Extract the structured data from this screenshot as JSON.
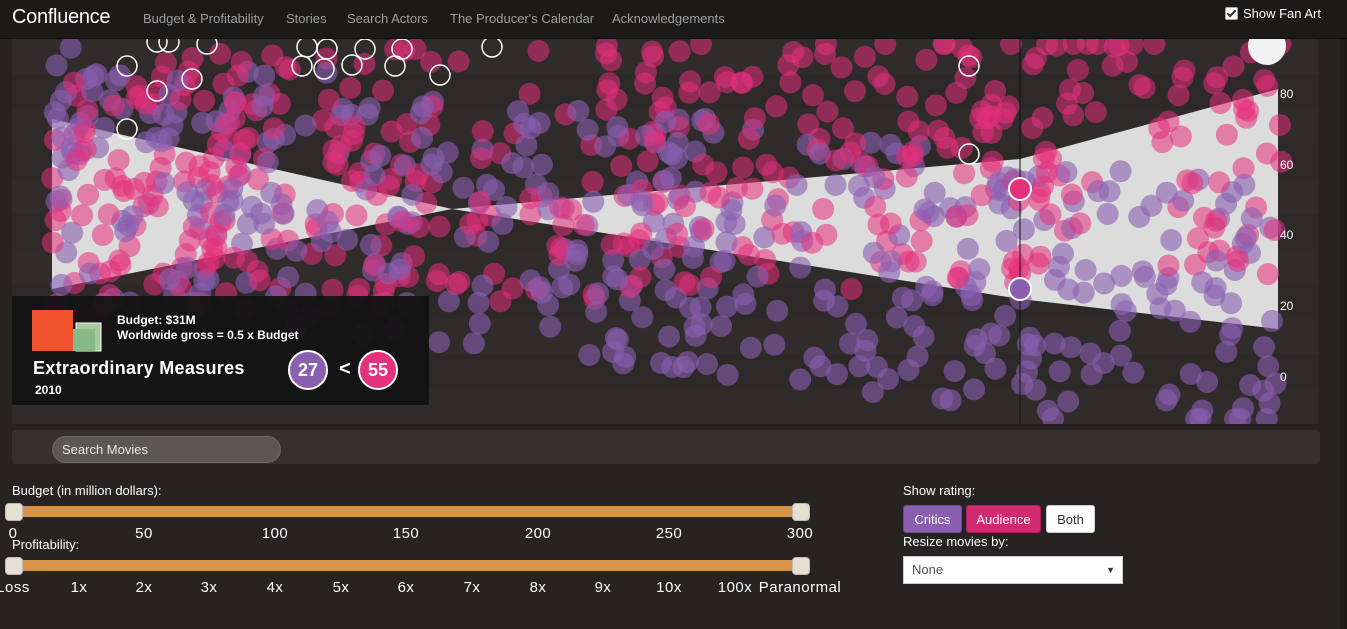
{
  "nav": {
    "brand": "Confluence",
    "items": [
      "Budget & Profitability",
      "Stories",
      "Search Actors",
      "The Producer's Calendar",
      "Acknowledgements"
    ],
    "fan_art_label": "Show Fan Art",
    "fan_art_checked": true
  },
  "plot": {
    "y_ticks": [
      "80",
      "60",
      "40",
      "20",
      "0"
    ],
    "colors": {
      "critics": "#8b5fb0",
      "audience": "#e5307c",
      "band": "#dcdcdc"
    }
  },
  "movie": {
    "budget": "Budget: $31M",
    "gross": "Worldwide gross = 0.5 x Budget",
    "title": "Extraordinary Measures",
    "year": "2010",
    "critics_score": "27",
    "comparator": "<",
    "audience_score": "55"
  },
  "search": {
    "placeholder": "Search Movies"
  },
  "budget_slider": {
    "label": "Budget (in million dollars):",
    "ticks": [
      "0",
      "50",
      "100",
      "150",
      "200",
      "250",
      "300"
    ]
  },
  "profit_slider": {
    "label": "Profitability:",
    "ticks": [
      "Loss",
      "1x",
      "2x",
      "3x",
      "4x",
      "5x",
      "6x",
      "7x",
      "8x",
      "9x",
      "10x",
      "100x",
      "Paranormal"
    ]
  },
  "rating": {
    "label": "Show rating:",
    "buttons": [
      "Critics",
      "Audience",
      "Both"
    ]
  },
  "resize": {
    "label": "Resize movies by:",
    "selected": "None"
  }
}
